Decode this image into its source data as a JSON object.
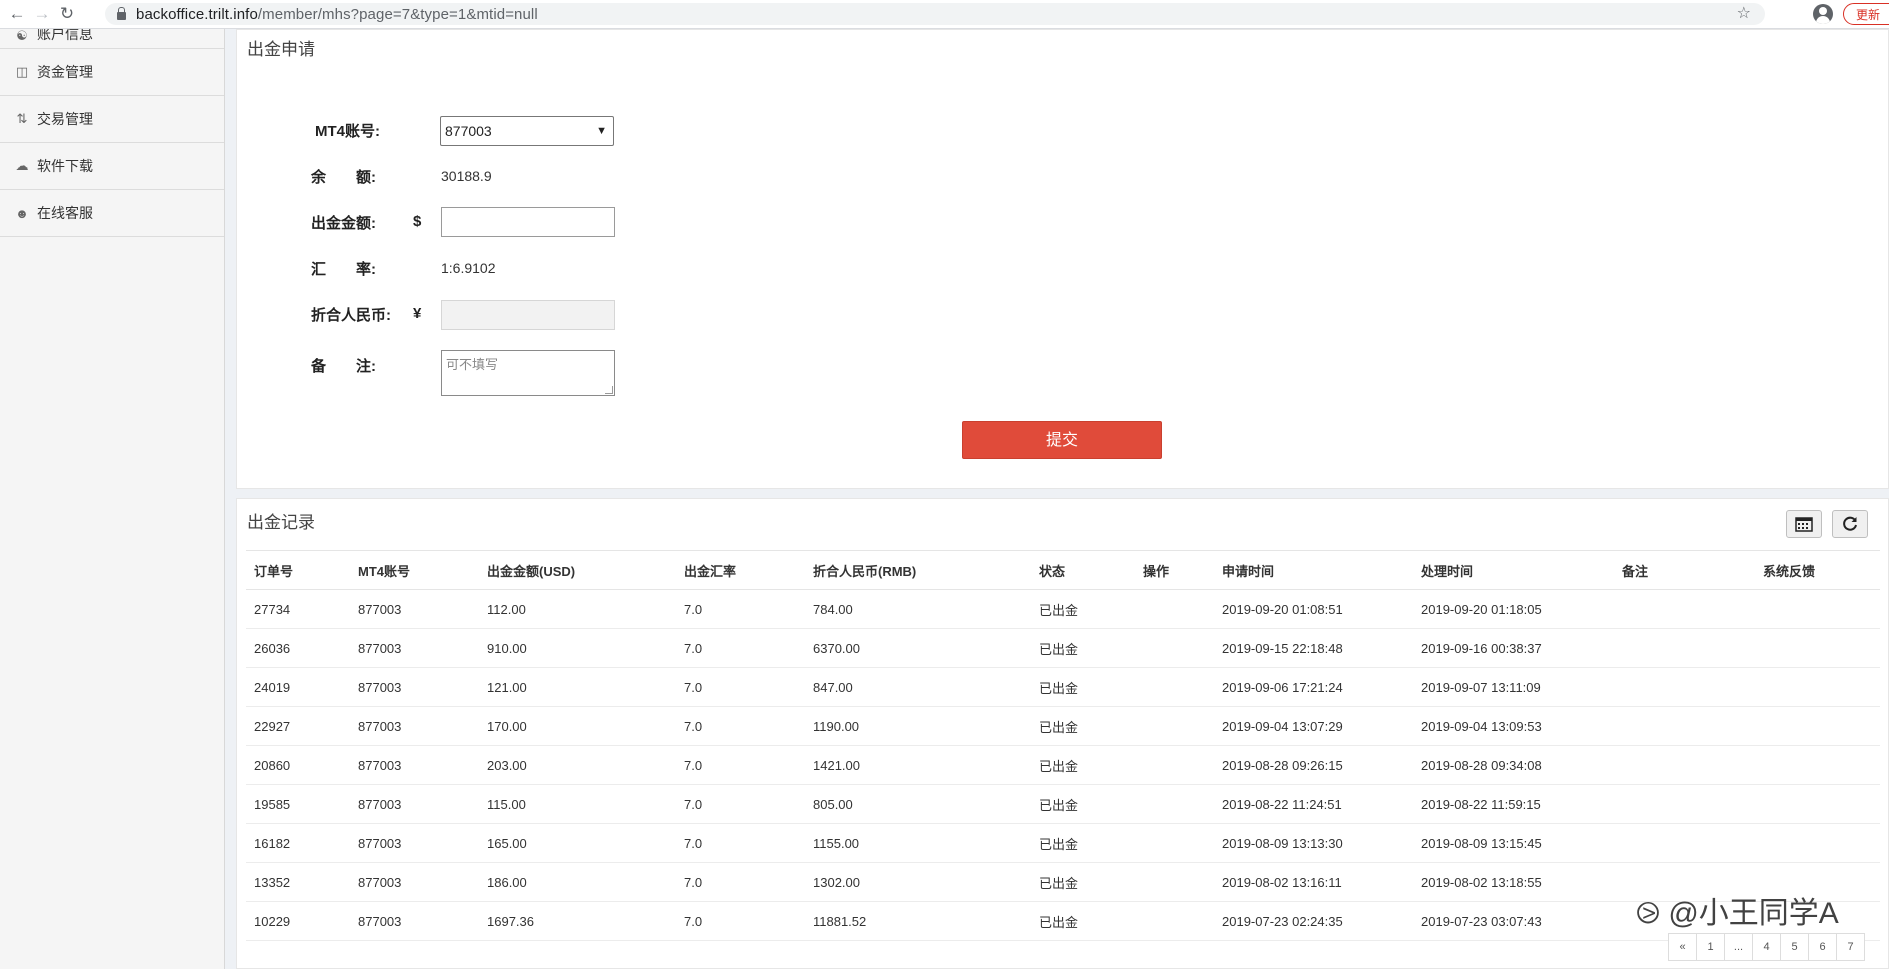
{
  "browser": {
    "url_host": "backoffice.trilt.info",
    "url_path": "/member/mhs?page=7&type=1&mtid=null",
    "update_label": "更新"
  },
  "sidebar": {
    "items": [
      {
        "label": "账户信息",
        "icon": "account-icon"
      },
      {
        "label": "资金管理",
        "icon": "funds-icon"
      },
      {
        "label": "交易管理",
        "icon": "trade-icon"
      },
      {
        "label": "软件下载",
        "icon": "download-icon"
      },
      {
        "label": "在线客服",
        "icon": "user-icon"
      }
    ]
  },
  "form": {
    "title": "出金申请",
    "account_label": "MT4账号:",
    "account_value": "877003",
    "balance_label": "余　　额:",
    "balance_value": "30188.9",
    "amount_label": "出金金额:",
    "amount_symbol": "$",
    "rate_label": "汇　　率:",
    "rate_value": "1:6.9102",
    "rmb_label": "折合人民币:",
    "rmb_symbol": "¥",
    "note_label": "备　　注:",
    "note_placeholder": "可不填写",
    "submit_label": "提交"
  },
  "records": {
    "title": "出金记录",
    "columns": [
      "订单号",
      "MT4账号",
      "出金金额(USD)",
      "出金汇率",
      "折合人民币(RMB)",
      "状态",
      "操作",
      "申请时间",
      "处理时间",
      "备注",
      "系统反馈"
    ],
    "rows": [
      [
        "27734",
        "877003",
        "112.00",
        "7.0",
        "784.00",
        "已出金",
        "",
        "2019-09-20 01:08:51",
        "2019-09-20 01:18:05",
        "",
        ""
      ],
      [
        "26036",
        "877003",
        "910.00",
        "7.0",
        "6370.00",
        "已出金",
        "",
        "2019-09-15 22:18:48",
        "2019-09-16 00:38:37",
        "",
        ""
      ],
      [
        "24019",
        "877003",
        "121.00",
        "7.0",
        "847.00",
        "已出金",
        "",
        "2019-09-06 17:21:24",
        "2019-09-07 13:11:09",
        "",
        ""
      ],
      [
        "22927",
        "877003",
        "170.00",
        "7.0",
        "1190.00",
        "已出金",
        "",
        "2019-09-04 13:07:29",
        "2019-09-04 13:09:53",
        "",
        ""
      ],
      [
        "20860",
        "877003",
        "203.00",
        "7.0",
        "1421.00",
        "已出金",
        "",
        "2019-08-28 09:26:15",
        "2019-08-28 09:34:08",
        "",
        ""
      ],
      [
        "19585",
        "877003",
        "115.00",
        "7.0",
        "805.00",
        "已出金",
        "",
        "2019-08-22 11:24:51",
        "2019-08-22 11:59:15",
        "",
        ""
      ],
      [
        "16182",
        "877003",
        "165.00",
        "7.0",
        "1155.00",
        "已出金",
        "",
        "2019-08-09 13:13:30",
        "2019-08-09 13:15:45",
        "",
        ""
      ],
      [
        "13352",
        "877003",
        "186.00",
        "7.0",
        "1302.00",
        "已出金",
        "",
        "2019-08-02 13:16:11",
        "2019-08-02 13:18:55",
        "",
        ""
      ],
      [
        "10229",
        "877003",
        "1697.36",
        "7.0",
        "11881.52",
        "已出金",
        "",
        "2019-07-23 02:24:35",
        "2019-07-23 03:07:43",
        "",
        ""
      ]
    ],
    "pagination": [
      "«",
      "1",
      "...",
      "4",
      "5",
      "6",
      "7"
    ]
  },
  "watermark": "@小王同学A"
}
